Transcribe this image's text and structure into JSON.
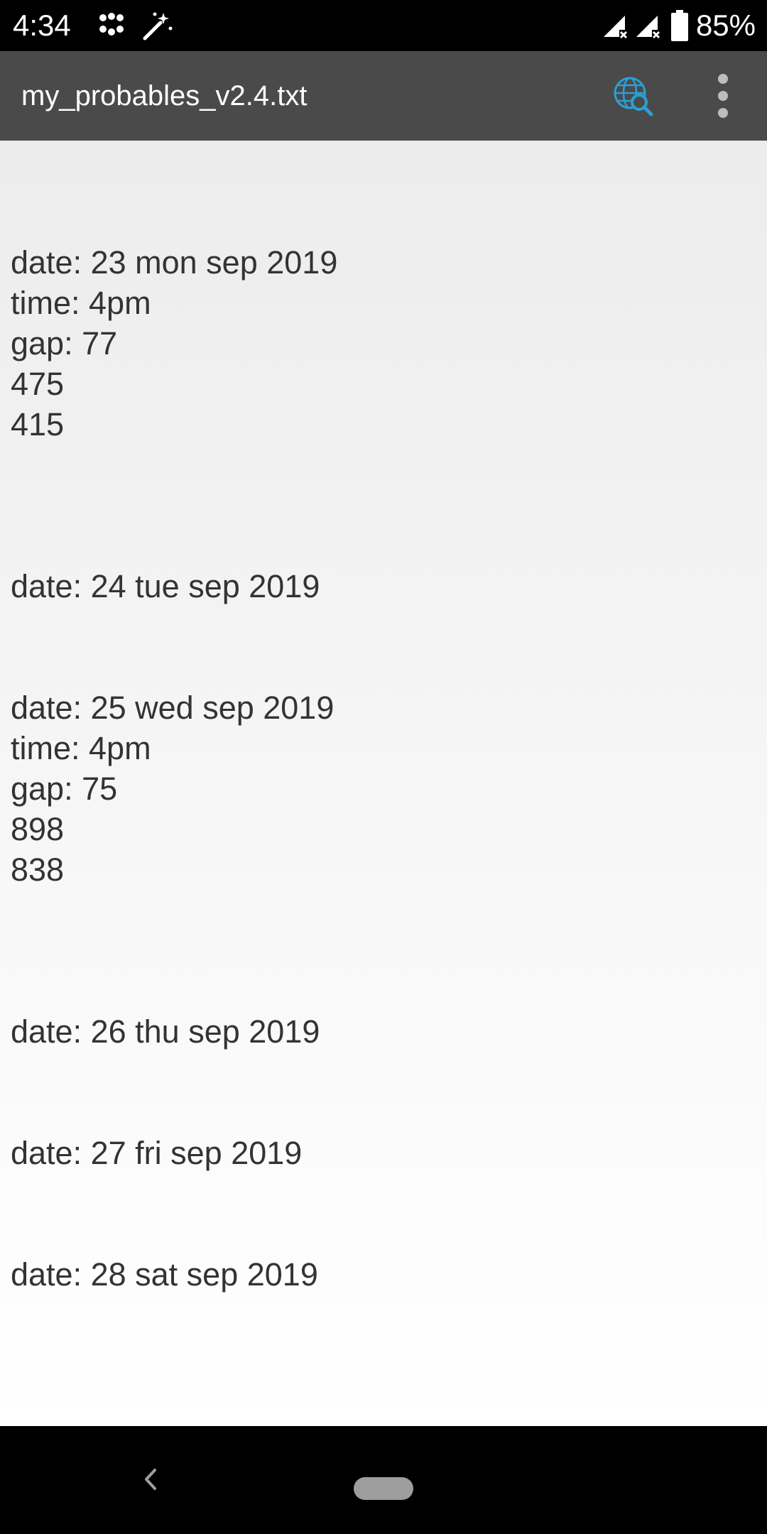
{
  "status_bar": {
    "time": "4:34",
    "notification_icons": [
      "dots-icon",
      "magic-wand-icon"
    ],
    "signal_icons": [
      "signal-no-data-icon",
      "signal-no-data-icon"
    ],
    "battery_icon": "battery-icon",
    "battery_percent": "85%"
  },
  "toolbar": {
    "file_name": "my_probables_v2.4.txt",
    "search_web_icon": "globe-search-icon",
    "overflow_icon": "more-vert-icon",
    "accent_color": "#2b9fd6"
  },
  "document": {
    "text": "date: 23 mon sep 2019\ntime: 4pm\ngap: 77\n475\n415\n\n\n\ndate: 24 tue sep 2019\n\n\ndate: 25 wed sep 2019\ntime: 4pm\ngap: 75\n898\n838\n\n\n\ndate: 26 thu sep 2019\n\n\ndate: 27 fri sep 2019\n\n\ndate: 28 sat sep 2019"
  },
  "nav_bar": {
    "back_icon": "back-chevron-icon",
    "home_icon": "home-pill-icon"
  }
}
